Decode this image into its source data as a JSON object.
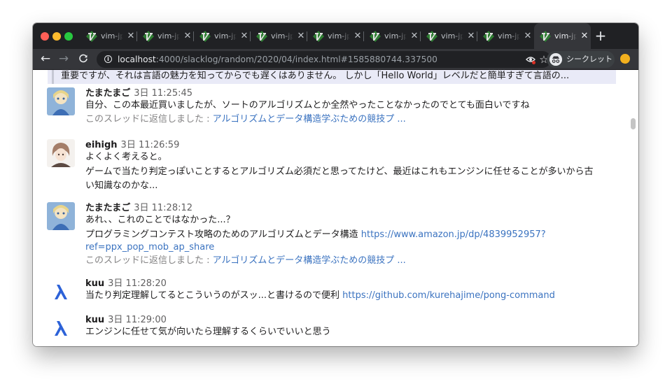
{
  "window": {
    "tabs": [
      {
        "title": "vim-jp",
        "close": "✕",
        "active": false
      },
      {
        "title": "vim-jp",
        "close": "✕",
        "active": false
      },
      {
        "title": "vim-jp",
        "close": "✕",
        "active": false
      },
      {
        "title": "vim-jp",
        "close": "✕",
        "active": false
      },
      {
        "title": "vim-jp",
        "close": "✕",
        "active": false
      },
      {
        "title": "vim-jp",
        "close": "✕",
        "active": false
      },
      {
        "title": "vim-jp",
        "close": "✕",
        "active": false
      },
      {
        "title": "vim-jp",
        "close": "✕",
        "active": false
      },
      {
        "title": "vim-jp",
        "close": "✕",
        "active": true
      }
    ],
    "new_tab": "+",
    "tab_icon": "vim-logo-icon"
  },
  "toolbar": {
    "back": "←",
    "forward": "→",
    "reload": "C",
    "info": "i",
    "url_host": "localhost",
    "url_path": ":4000/slacklog/random/2020/04/index.html#1585880744.337500",
    "star": "☆",
    "incognito_label": "シークレット"
  },
  "content": {
    "quote_text": "重要ですが、それは言語の魅力を知ってからでも遅くはありません。 しかし「Hello World」レベルだと簡単すぎて言語の...",
    "messages": [
      {
        "user": "たまたまご",
        "time": "3日 11:25:45",
        "lines": [
          "自分、この本最近買いましたが、ソートのアルゴリズムとか全然やったことなかったのでとても面白いですね"
        ],
        "thread_prefix": "このスレッドに返信しました : ",
        "thread_link": "アルゴリズムとデータ構造学ぶための競技プ ..."
      },
      {
        "user": "eihigh",
        "time": "3日 11:26:59",
        "lines": [
          "よくよく考えると。",
          "ゲームで当たり判定っぽいことするとアルゴリズム必須だと思ってたけど、最近はこれもエンジンに任せることが多いから古",
          "い知識なのかな..."
        ]
      },
      {
        "user": "たまたまご",
        "time": "3日 11:28:12",
        "lines": [
          "あれ、、これのことではなかった...？"
        ],
        "link_text": "プログラミングコンテスト攻略のためのアルゴリズムとデータ構造 ",
        "link_url_1": "https://www.amazon.jp/dp/4839952957?",
        "link_url_2": "ref=ppx_pop_mob_ap_share",
        "thread_prefix": "このスレッドに返信しました : ",
        "thread_link": "アルゴリズムとデータ構造学ぶための競技プ ..."
      },
      {
        "user": "kuu",
        "time": "3日 11:28:20",
        "text": "当たり判定理解してるとこういうのがスッ...と書けるので便利 ",
        "link": "https://github.com/kurehajime/pong-command"
      },
      {
        "user": "kuu",
        "time": "3日 11:29:00",
        "lines": [
          "エンジンに任せて気が向いたら理解するくらいでいいと思う"
        ]
      }
    ]
  }
}
